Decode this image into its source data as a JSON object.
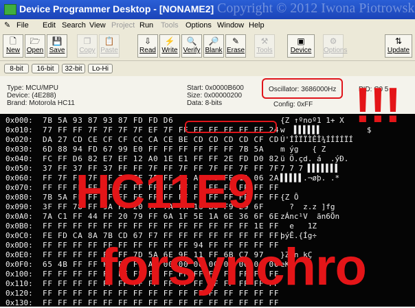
{
  "window": {
    "title": "Device Programmer Desktop - [NONAME2]",
    "watermark": "Copyright © 2012 Iwona Piotrowska"
  },
  "menu": [
    {
      "label": "File",
      "enabled": true
    },
    {
      "label": "Edit",
      "enabled": true
    },
    {
      "label": "Search",
      "enabled": true
    },
    {
      "label": "View",
      "enabled": true
    },
    {
      "label": "Project",
      "enabled": false
    },
    {
      "label": "Run",
      "enabled": true
    },
    {
      "label": "Tools",
      "enabled": false
    },
    {
      "label": "Options",
      "enabled": true
    },
    {
      "label": "Window",
      "enabled": true
    },
    {
      "label": "Help",
      "enabled": true
    }
  ],
  "toolbar": [
    {
      "label": "New",
      "icon": "new-file-icon",
      "enabled": true
    },
    {
      "label": "Open",
      "icon": "open-folder-icon",
      "enabled": true
    },
    {
      "label": "Save",
      "icon": "save-icon",
      "enabled": true
    },
    {
      "label": "Copy",
      "icon": "copy-icon",
      "enabled": false
    },
    {
      "label": "Paste",
      "icon": "paste-icon",
      "enabled": false
    },
    {
      "label": "Read",
      "icon": "read-icon",
      "enabled": true
    },
    {
      "label": "Write",
      "icon": "write-icon",
      "enabled": true
    },
    {
      "label": "Verify",
      "icon": "verify-icon",
      "enabled": true
    },
    {
      "label": "Blank",
      "icon": "blank-check-icon",
      "enabled": true
    },
    {
      "label": "Erase",
      "icon": "erase-icon",
      "enabled": true
    },
    {
      "label": "Tools",
      "icon": "tools-icon",
      "enabled": false
    },
    {
      "label": "Device",
      "icon": "device-chip-icon",
      "enabled": true
    },
    {
      "label": "Options",
      "icon": "options-icon",
      "enabled": false
    },
    {
      "label": "Update",
      "icon": "update-icon",
      "enabled": true
    }
  ],
  "view_tabs": [
    "8-bit",
    "16-bit",
    "32-bit",
    "Lo-Hi"
  ],
  "device_info": {
    "type": "Type: MCU/MPU",
    "device": "Device: (4E288)",
    "brand": "Brand: Motorola HC11",
    "start": "Start: 0x0000B600",
    "size": "Size: 0x00000200",
    "data": "Data: 8-bits",
    "oscillator": "Oscillator: 3686000Hz",
    "config": "Config: 0xFF",
    "pid": "PID: C0 5"
  },
  "hex_rows": [
    {
      "addr": "0x000:",
      "bytes": "7B 5A 93 87 93 87 FD FD D6",
      "ascii": "{Z ↑ºnoº1 1+ X"
    },
    {
      "addr": "0x010:",
      "bytes": "77 FF FF 7F 7F 7F 7F EF 7F FF FF FF FF FF FF 24",
      "ascii": "w  ▌▌▌▌▌▌          $"
    },
    {
      "addr": "0x020:",
      "bytes": "DA 27 CD CE CF CF CC CA CE BE CD CD CD CD CF CD",
      "ascii": "Ú'ÍÎÏÏÌÊÎ¾ÍÍÍÍÏÍ"
    },
    {
      "addr": "0x030:",
      "bytes": "6D 88 94 FD 67 99 E0 FF FF FF FF FF FF 7B 5A",
      "ascii": "m ýg   { Z"
    },
    {
      "addr": "0x040:",
      "bytes": "FC FF D6 82 E7 EF 12 A0 1E E1 FF FF 2E FD D0 82",
      "ascii": "ü Ö.çd. á  .ýÐ."
    },
    {
      "addr": "0x050:",
      "bytes": "37 FF 37 FF 37 FF FF 7F FF 7F FF 7F FF 7F FF 7F",
      "ascii": "7 7 7 ▌▌▌▌▌▌▌"
    },
    {
      "addr": "0x060:",
      "bytes": "FF 7F FF 7F FF 7F FF 7F FF 04 AC F8 FE 1A 06 2A",
      "ascii": "▌▌▌▌▌.¬øþ. .*"
    },
    {
      "addr": "0x070:",
      "bytes": "FF FF FF FF FF FF FF FF FF FF FF FF FF FF FF FF",
      "ascii": ""
    },
    {
      "addr": "0x080:",
      "bytes": "7B 5A FF FF FF FF FF FF FF FF FF FF FF FF FF FF",
      "ascii": "{Z Ô"
    },
    {
      "addr": "0x090:",
      "bytes": "3F FF 78 FF 9A FF 20 7F 7A 7A 16 B0 F9 29 6F",
      "ascii": "  ?  z.z ]fg"
    },
    {
      "addr": "0x0A0:",
      "bytes": "7A C1 FF 44 FF 20 79 FF 6A 1F 5E 1A 6E 36 6F 6E",
      "ascii": "zÁnc¹V  ãn6Õn"
    },
    {
      "addr": "0x0B0:",
      "bytes": "FF FF FF FF FF FF FF FF FF FF FF FF FF FF 1E FF",
      "ascii": "  e   1Z"
    },
    {
      "addr": "0x0C0:",
      "bytes": "FE FD CA 8A 7B CD 67 F7 FF FF FF FF FF FF FF FF",
      "ascii": "þýÊ.{Íg÷"
    },
    {
      "addr": "0x0D0:",
      "bytes": "FF FF FF FF FF FF FF FF FF FF 94 FF FF FF FF FF",
      "ascii": ""
    },
    {
      "addr": "0x0E0:",
      "bytes": "FF FF FF FF FF FF 7D 5A 6E 9E 11 FF 6B C7 97",
      "ascii": "}Z n kÇ"
    },
    {
      "addr": "0x0F0:",
      "bytes": "65 4B FF FF FF FF FF A2 00 00 00 00 00 00 00 00",
      "ascii": "eK"
    },
    {
      "addr": "0x100:",
      "bytes": "FF FF FF FF FF FF FF FF FF FF FF FF FF FF FF FF",
      "ascii": ""
    },
    {
      "addr": "0x110:",
      "bytes": "FF FF FF FF FF FF FF FF FF FF FF FF FF FF FF FF",
      "ascii": ""
    },
    {
      "addr": "0x120:",
      "bytes": "FF FF FF FF FF FF FF FF FF FF FF FF FF FF FF FF",
      "ascii": ""
    },
    {
      "addr": "0x130:",
      "bytes": "FF FF FF FF FF FF FF FF FF FF FF FF FF FF FF FF",
      "ascii": ""
    }
  ],
  "overlay": {
    "exclamation": "!!!",
    "line1": "HC11E9",
    "line2": "forsynchro"
  },
  "colors": {
    "title_bar": "#1b44b8",
    "chrome": "#ece9d8",
    "annotation_red": "#e41518",
    "hex_background": "#050505"
  }
}
